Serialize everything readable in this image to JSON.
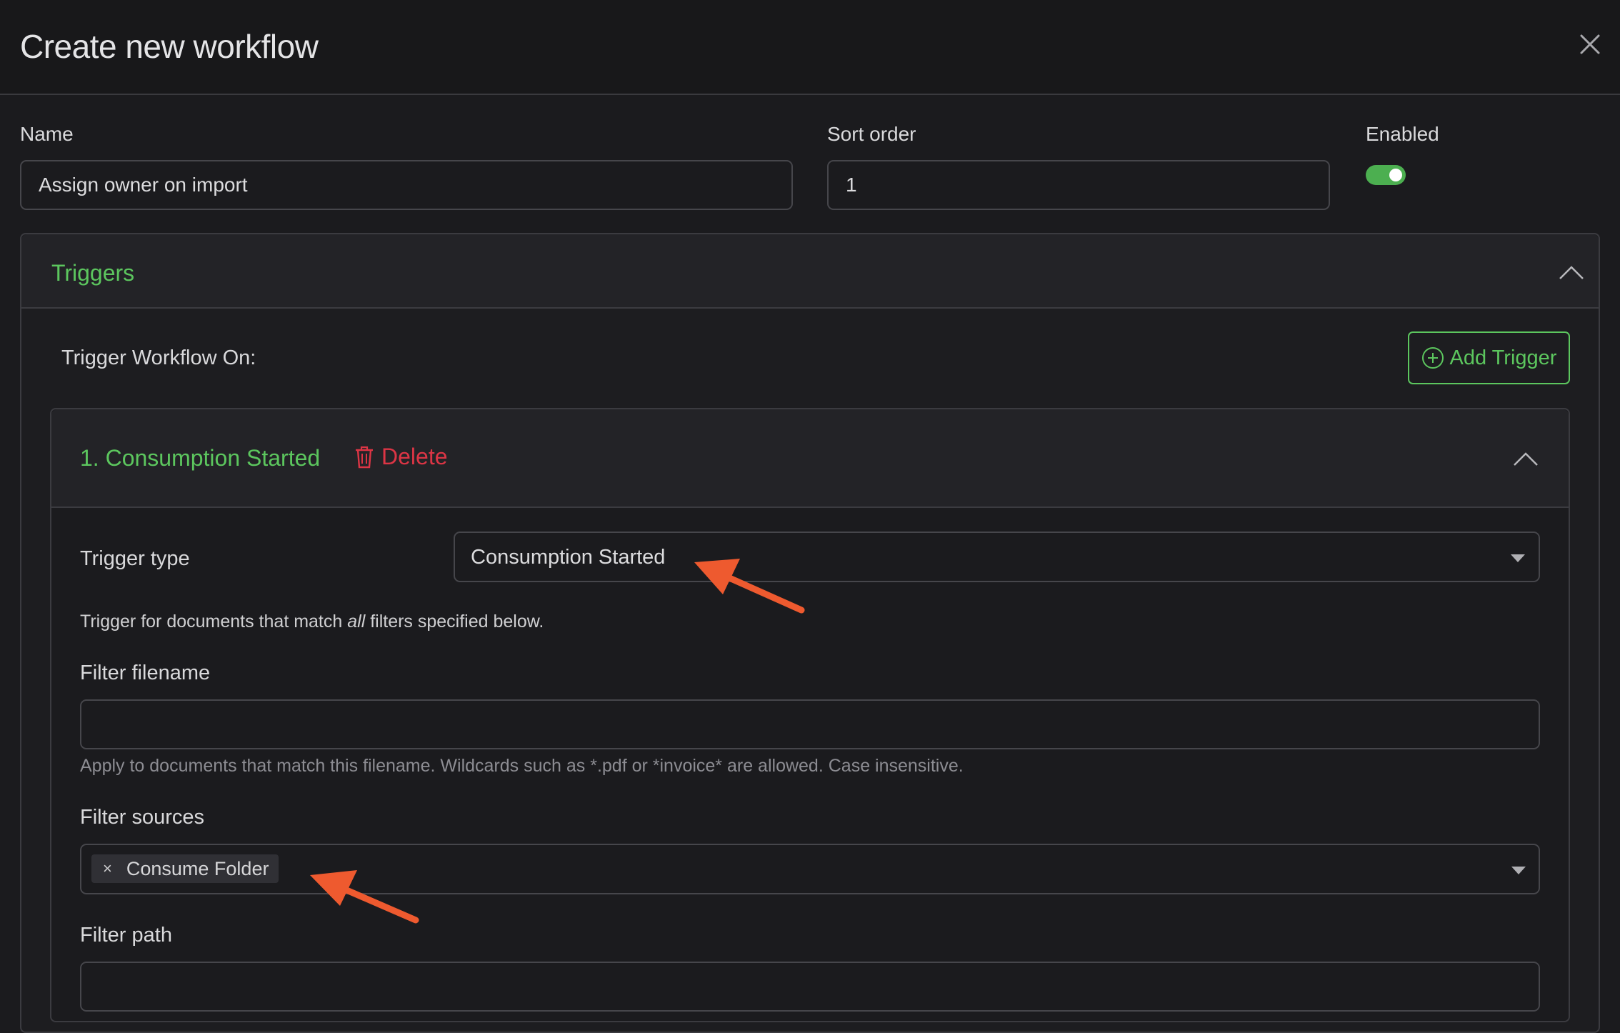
{
  "dialog": {
    "title": "Create new workflow",
    "close_icon": "close-icon"
  },
  "form": {
    "name_label": "Name",
    "name_value": "Assign owner on import",
    "sort_order_label": "Sort order",
    "sort_order_value": "1",
    "enabled_label": "Enabled",
    "enabled": true
  },
  "triggers": {
    "section_title": "Triggers",
    "trigger_on_label": "Trigger Workflow On:",
    "add_trigger_label": "Add Trigger",
    "items": [
      {
        "title": "1. Consumption Started",
        "delete_label": "Delete",
        "trigger_type_label": "Trigger type",
        "trigger_type_value": "Consumption Started",
        "help_prefix": "Trigger for documents that match ",
        "help_emphasis": "all",
        "help_suffix": " filters specified below.",
        "filter_filename_label": "Filter filename",
        "filter_filename_value": "",
        "filter_filename_hint": "Apply to documents that match this filename. Wildcards such as *.pdf or *invoice* are allowed. Case insensitive.",
        "filter_sources_label": "Filter sources",
        "filter_sources_selected": [
          "Consume Folder"
        ],
        "chip_remove_glyph": "×",
        "filter_path_label": "Filter path",
        "filter_path_value": ""
      }
    ]
  },
  "colors": {
    "accent_green": "#5cc65e",
    "danger_red": "#dc3545",
    "annotation_arrow": "#ee5a2f",
    "background": "#1b1b1e"
  },
  "icons": [
    "close-icon",
    "chevron-up-icon",
    "plus-circle-icon",
    "trash-icon",
    "caret-down-icon",
    "annotation-arrow-icon"
  ]
}
